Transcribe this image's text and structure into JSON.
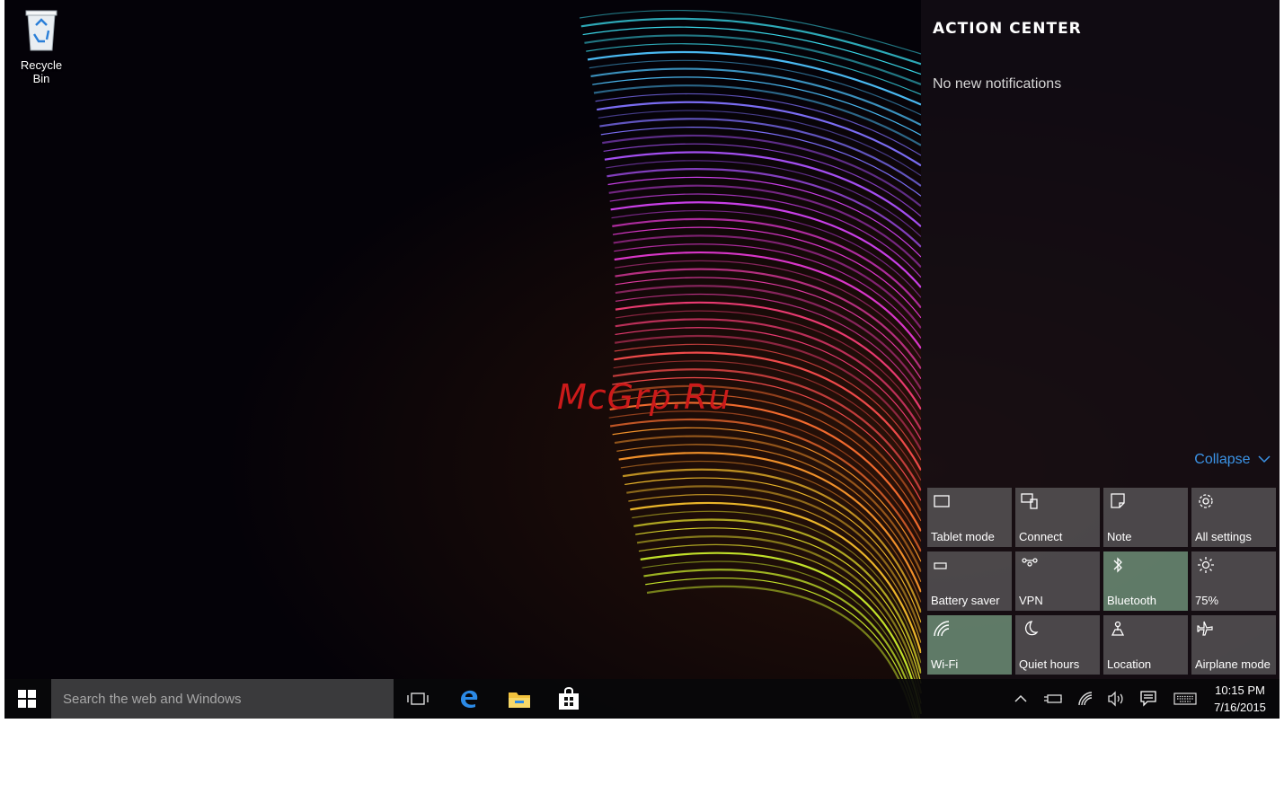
{
  "desktop": {
    "recycle_bin_label": "Recycle Bin",
    "watermark": "McGrp.Ru"
  },
  "action_center": {
    "title": "ACTION CENTER",
    "empty_message": "No new notifications",
    "collapse_label": "Collapse",
    "accent_color": "#3b93e6",
    "tiles": [
      {
        "label": "Tablet mode",
        "icon": "tablet-icon",
        "active": false
      },
      {
        "label": "Connect",
        "icon": "connect-icon",
        "active": false
      },
      {
        "label": "Note",
        "icon": "note-icon",
        "active": false
      },
      {
        "label": "All settings",
        "icon": "gear-icon",
        "active": false
      },
      {
        "label": "Battery saver",
        "icon": "battery-icon",
        "active": false
      },
      {
        "label": "VPN",
        "icon": "vpn-icon",
        "active": false
      },
      {
        "label": "Bluetooth",
        "icon": "bluetooth-icon",
        "active": true
      },
      {
        "label": "75%",
        "icon": "brightness-icon",
        "active": false
      },
      {
        "label": "Wi-Fi",
        "icon": "wifi-icon",
        "active": true
      },
      {
        "label": "Quiet hours",
        "icon": "moon-icon",
        "active": false
      },
      {
        "label": "Location",
        "icon": "location-icon",
        "active": false
      },
      {
        "label": "Airplane mode",
        "icon": "airplane-icon",
        "active": false
      }
    ]
  },
  "taskbar": {
    "search_placeholder": "Search the web and Windows",
    "clock_time": "10:15 PM",
    "clock_date": "7/16/2015"
  }
}
